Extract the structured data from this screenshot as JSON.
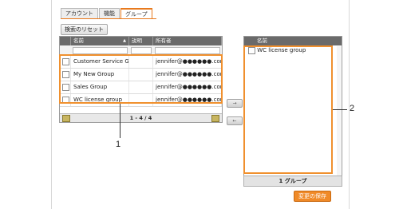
{
  "tabs": [
    "アカウント",
    "機能",
    "グループ"
  ],
  "active_tab": 2,
  "reset_label": "検索のリセット",
  "left_grid": {
    "columns": [
      "名前",
      "説明",
      "所有者"
    ],
    "rows": [
      {
        "name": "Customer Service G",
        "desc": "",
        "owner": "jennifer@●●●●●●.com"
      },
      {
        "name": "My New Group",
        "desc": "",
        "owner": "jennifer@●●●●●●.com"
      },
      {
        "name": "Sales Group",
        "desc": "",
        "owner": "jennifer@●●●●●●.com"
      },
      {
        "name": "WC license group",
        "desc": "",
        "owner": "jennifer@●●●●●●.com"
      }
    ],
    "pager": "1 - 4 / 4"
  },
  "move_buttons": [
    "→",
    "←"
  ],
  "right_list": {
    "column": "名前",
    "items": [
      "WC license group"
    ],
    "footer": "1 グループ"
  },
  "save_label": "変更の保存",
  "callouts": [
    "1",
    "2"
  ],
  "accent": "#f0902e"
}
